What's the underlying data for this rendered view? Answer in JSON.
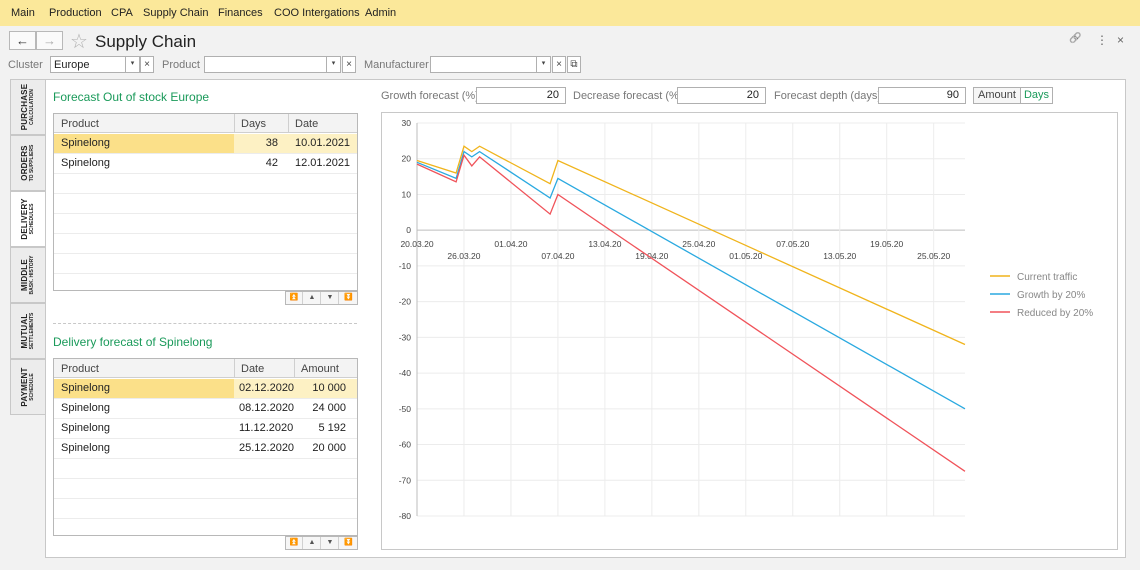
{
  "menu": [
    "Main",
    "Production",
    "CPA",
    "Supply Chain",
    "Finances",
    "COO Intergations",
    "Admin"
  ],
  "nav": {
    "back_icon": "arrow-left-icon",
    "forward_icon": "arrow-right-icon",
    "back_glyph": "←",
    "forward_glyph": "→"
  },
  "page_title": "Supply Chain",
  "icons": {
    "favorite": "star-icon",
    "link": "link-icon",
    "menu": "kebab-menu-icon",
    "close": "close-icon",
    "star_glyph": "☆",
    "link_glyph": "🔗",
    "menu_glyph": "⋮",
    "close_glyph": "×",
    "dropdown_glyph": "▾",
    "clear_glyph": "×",
    "open_glyph": "⧉"
  },
  "filters": {
    "cluster_label": "Cluster",
    "cluster_value": "Europe",
    "product_label": "Product",
    "product_value": "",
    "manufacturer_label": "Manufacturer",
    "manufacturer_value": ""
  },
  "side_tabs": [
    {
      "title": "PURCHASE",
      "subtitle": "CALCULATION",
      "active": false
    },
    {
      "title": "ORDERS",
      "subtitle": "TO SUPPLIERS",
      "active": false
    },
    {
      "title": "DELIVERY",
      "subtitle": "SCHEDULES",
      "active": true
    },
    {
      "title": "MIDDLE",
      "subtitle": "BASK. HISTORY",
      "active": false
    },
    {
      "title": "MUTUAL",
      "subtitle": "SETTLEMENTS",
      "active": false
    },
    {
      "title": "PAYMENT",
      "subtitle": "SCHEDULE",
      "active": false
    }
  ],
  "forecast_table": {
    "title": "Forecast Out of stock Europe",
    "columns": [
      "Product",
      "Days",
      "Date"
    ],
    "rows": [
      {
        "product": "Spinelong",
        "days": "38",
        "date": "10.01.2021",
        "selected": true
      },
      {
        "product": "Spinelong",
        "days": "42",
        "date": "12.01.2021",
        "selected": false
      }
    ]
  },
  "delivery_table": {
    "title": "Delivery forecast of Spinelong",
    "columns": [
      "Product",
      "Date",
      "Amount"
    ],
    "rows": [
      {
        "product": "Spinelong",
        "date": "02.12.2020",
        "amount": "10 000",
        "selected": true
      },
      {
        "product": "Spinelong",
        "date": "08.12.2020",
        "amount": "24 000",
        "selected": false
      },
      {
        "product": "Spinelong",
        "date": "11.12.2020",
        "amount": "5 192",
        "selected": false
      },
      {
        "product": "Spinelong",
        "date": "25.12.2020",
        "amount": "20 000",
        "selected": false
      }
    ]
  },
  "pager": {
    "first_glyph": "⏫",
    "prev_glyph": "▲",
    "next_glyph": "▼",
    "last_glyph": "⏬"
  },
  "params": {
    "growth_label": "Growth forecast (%)",
    "growth_value": "20",
    "decrease_label": "Decrease forecast (%)",
    "decrease_value": "20",
    "depth_label": "Forecast depth (days)",
    "depth_value": "90",
    "toggle_amount": "Amount",
    "toggle_days": "Days",
    "toggle_selected": "Days"
  },
  "colors": {
    "accent_green": "#1a9a5a",
    "menu_bg": "#fbe89a",
    "selected_row": "#fbe089"
  },
  "chart_data": {
    "type": "line",
    "yticks": [
      30,
      20,
      10,
      0,
      -10,
      -20,
      -30,
      -40,
      -50,
      -60,
      -70,
      -80
    ],
    "ylim": [
      -80,
      30
    ],
    "xticks": [
      "20.03.20",
      "26.03.20",
      "01.04.20",
      "07.04.20",
      "13.04.20",
      "19.04.20",
      "25.04.20",
      "01.05.20",
      "07.05.20",
      "13.05.20",
      "19.05.20",
      "25.05.20"
    ],
    "xlim": [
      "2020-03-20",
      "2020-05-29"
    ],
    "grid": true,
    "legend_position": "right",
    "series": [
      {
        "name": "Current traffic",
        "color": "#f0b41c",
        "points": [
          [
            "2020-03-20",
            19.5
          ],
          [
            "2020-03-25",
            16
          ],
          [
            "2020-03-26",
            23.5
          ],
          [
            "2020-03-27",
            22
          ],
          [
            "2020-03-28",
            23.5
          ],
          [
            "2020-04-06",
            13
          ],
          [
            "2020-04-07",
            19.5
          ],
          [
            "2020-05-29",
            -32
          ]
        ]
      },
      {
        "name": "Growth by 20%",
        "color": "#2aa9e0",
        "points": [
          [
            "2020-03-20",
            19
          ],
          [
            "2020-03-25",
            14.5
          ],
          [
            "2020-03-26",
            22
          ],
          [
            "2020-03-27",
            20.5
          ],
          [
            "2020-03-28",
            22
          ],
          [
            "2020-04-06",
            9
          ],
          [
            "2020-04-07",
            14.5
          ],
          [
            "2020-05-29",
            -50
          ]
        ]
      },
      {
        "name": "Reduced by 20%",
        "color": "#f0535a",
        "points": [
          [
            "2020-03-20",
            18.5
          ],
          [
            "2020-03-25",
            13.5
          ],
          [
            "2020-03-26",
            21
          ],
          [
            "2020-03-27",
            18
          ],
          [
            "2020-03-28",
            20.5
          ],
          [
            "2020-04-06",
            4.5
          ],
          [
            "2020-04-07",
            10
          ],
          [
            "2020-05-29",
            -67.5
          ]
        ]
      }
    ]
  }
}
